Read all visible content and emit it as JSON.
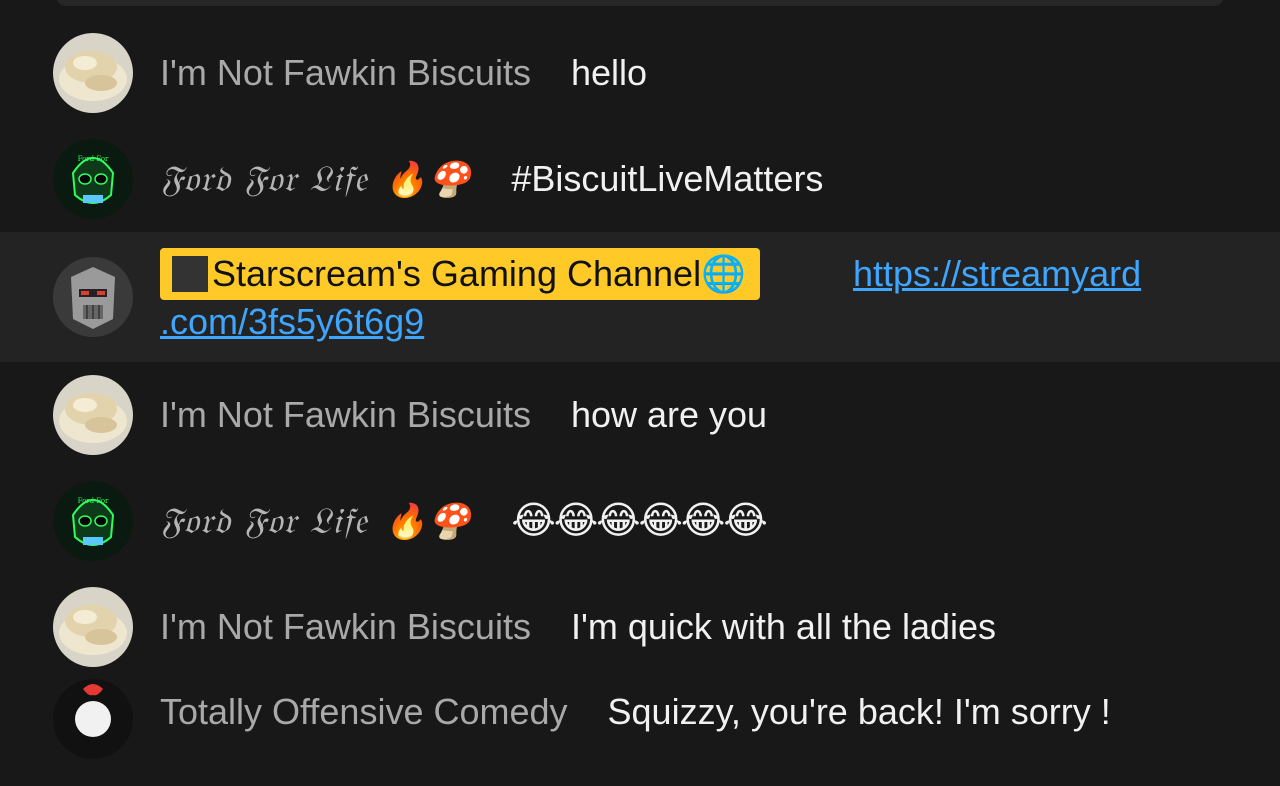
{
  "colors": {
    "background": "#181818",
    "author_text": "#a9a9a9",
    "message_text": "#f1f1f1",
    "member_highlight": "#ffca28",
    "link": "#3ea6ff"
  },
  "messages": [
    {
      "author": "I'm Not Fawkin Biscuits",
      "text": "hello",
      "avatar": "biscuit-avatar"
    },
    {
      "author": "𝔉𝔬𝔯𝔡 𝔉𝔬𝔯 𝔏𝔦𝔣𝔢",
      "author_suffix": "🔥🍄",
      "text": "#BiscuitLiveMatters",
      "avatar": "skull-avatar"
    },
    {
      "author": "Starscream's Gaming Channel",
      "author_suffix": "🌐",
      "link_line1": "https://streamyard",
      "link_line2": ".com/3fs5y6t6g9",
      "avatar": "robot-avatar"
    },
    {
      "author": "I'm Not Fawkin Biscuits",
      "text": "how are you",
      "avatar": "biscuit-avatar"
    },
    {
      "author": "𝔉𝔬𝔯𝔡 𝔉𝔬𝔯 𝔏𝔦𝔣𝔢",
      "author_suffix": "🔥🍄",
      "text": "😂😂😂😂😂😂",
      "avatar": "skull-avatar"
    },
    {
      "author": "I'm Not Fawkin Biscuits",
      "text": "I'm quick with all the ladies",
      "avatar": "biscuit-avatar"
    },
    {
      "author": "Totally Offensive Comedy",
      "text": "Squizzy, you're back! I'm sorry !",
      "avatar": "comedy-avatar"
    }
  ]
}
